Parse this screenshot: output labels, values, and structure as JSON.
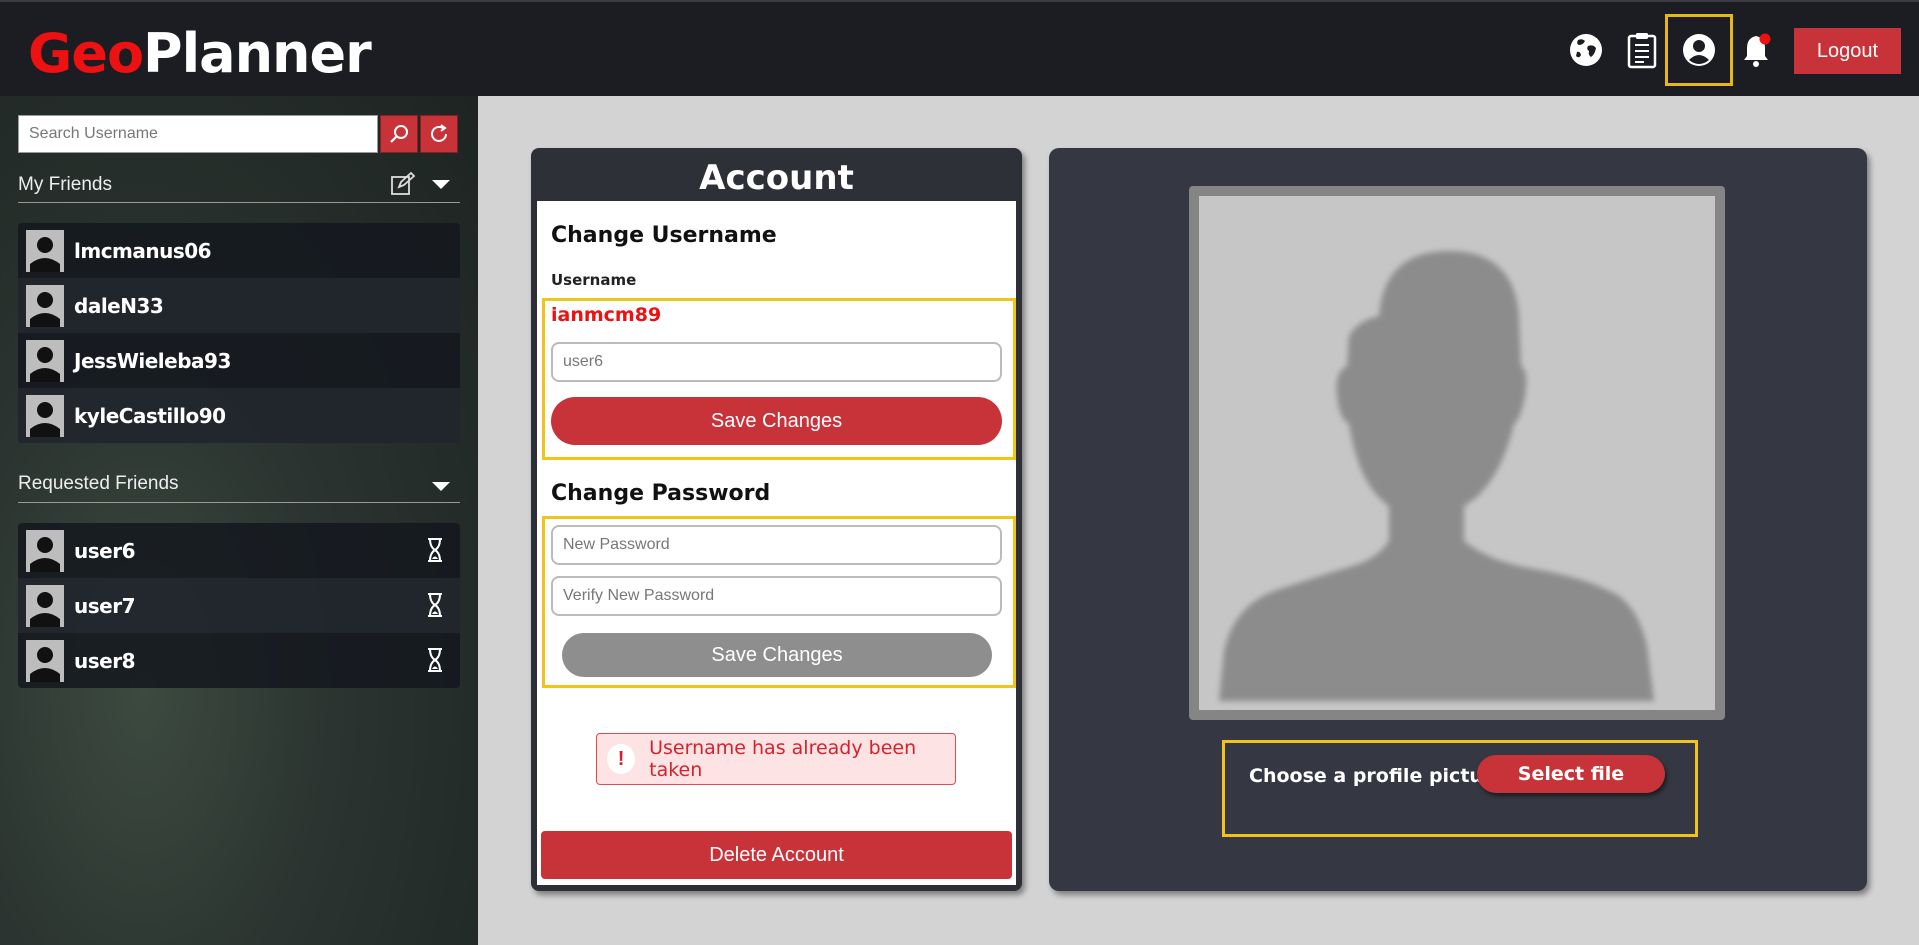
{
  "app": {
    "logo_part1": "Geo",
    "logo_part2": "Planner"
  },
  "header": {
    "icons": [
      "globe-icon",
      "clipboard-icon",
      "profile-icon",
      "bell-icon"
    ],
    "logout_label": "Logout"
  },
  "sidebar": {
    "search_placeholder": "Search Username",
    "friends_title": "My Friends",
    "friends": [
      {
        "name": "lmcmanus06"
      },
      {
        "name": "daleN33"
      },
      {
        "name": "JessWieleba93"
      },
      {
        "name": "kyleCastillo90"
      }
    ],
    "requested_title": "Requested Friends",
    "requested": [
      {
        "name": "user6"
      },
      {
        "name": "user7"
      },
      {
        "name": "user8"
      }
    ]
  },
  "account": {
    "title": "Account",
    "change_username_title": "Change Username",
    "username_label": "Username",
    "current_username": "ianmcm89",
    "username_input_value": "user6",
    "save_username_label": "Save Changes",
    "change_password_title": "Change Password",
    "new_password_placeholder": "New Password",
    "verify_password_placeholder": "Verify New Password",
    "save_password_label": "Save Changes",
    "error_icon": "!",
    "error_message": "Username has already been taken",
    "delete_label": "Delete Account"
  },
  "picture": {
    "choose_label": "Choose a profile picture:",
    "select_file_label": "Select file"
  },
  "colors": {
    "accent": "#c8333a",
    "highlight": "#f0c419",
    "logo_red": "#ee1111"
  }
}
